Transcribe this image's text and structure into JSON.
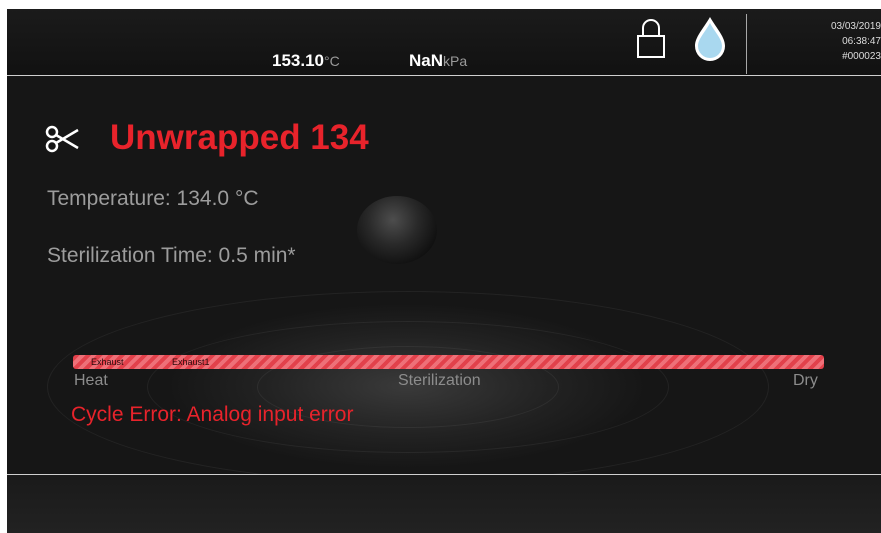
{
  "status_bar": {
    "temperature_value": "153.10",
    "temperature_unit": "°C",
    "pressure_value": "NaN",
    "pressure_unit": "kPa",
    "date": "03/03/2019",
    "time": "06:38:47",
    "cycle_number": "#000023"
  },
  "cycle": {
    "name": "Unwrapped 134",
    "temperature": "Temperature: 134.0 °C",
    "sterilization_time": "Sterilization Time: 0.5 min*"
  },
  "progress": {
    "stage_labels": [
      "Exhaust",
      "Exhaust1"
    ],
    "phases": [
      "Heat",
      "Sterilization",
      "Dry"
    ]
  },
  "error_message": "Cycle Error: Analog input error",
  "colors": {
    "accent_red": "#e8232b",
    "background": "#151515",
    "drop_fill": "#a9d8ef"
  },
  "icons": {
    "lock": "lock-icon",
    "water": "water-drop-icon",
    "cycle": "scissors-icon"
  }
}
